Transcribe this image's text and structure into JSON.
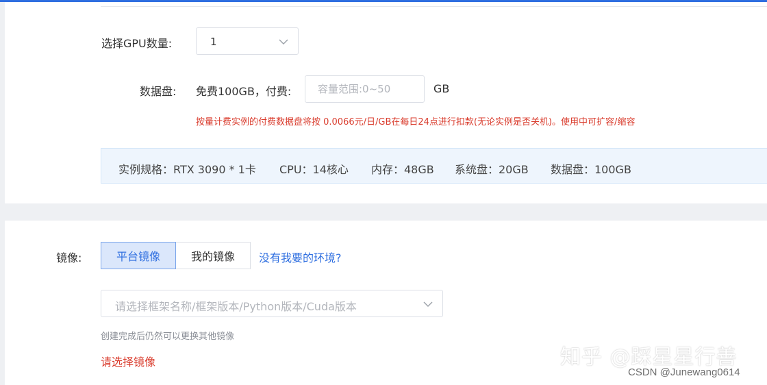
{
  "gpu": {
    "label": "选择GPU数量:",
    "value": "1"
  },
  "disk": {
    "label": "数据盘:",
    "free_text": "免费100GB，付费:",
    "placeholder": "容量范围:0~50",
    "unit": "GB",
    "warning": "按量计费实例的付费数据盘将按 0.0066元/日/GB在每日24点进行扣款(无论实例是否关机)。使用中可扩容/缩容"
  },
  "spec": {
    "instance": "实例规格：RTX 3090 * 1卡",
    "cpu": "CPU：14核心",
    "memory": "内存：48GB",
    "system_disk": "系统盘：20GB",
    "data_disk": "数据盘：100GB"
  },
  "image": {
    "label": "镜像:",
    "tabs": [
      {
        "label": "平台镜像",
        "active": true
      },
      {
        "label": "我的镜像",
        "active": false
      }
    ],
    "help_link": "没有我要的环境?",
    "placeholder": "请选择框架名称/框架版本/Python版本/Cuda版本",
    "hint": "创建完成后仍然可以更换其他镜像",
    "error": "请选择镜像"
  },
  "watermark": {
    "zhihu": "知乎 @踩星星行善",
    "csdn": "CSDN @Junewang0614"
  },
  "colors": {
    "accent": "#2f6fe0",
    "error": "#d93a2b",
    "spec_bg": "#eef5fd"
  },
  "icons": {
    "select_arrow": "chevron-down-icon"
  }
}
